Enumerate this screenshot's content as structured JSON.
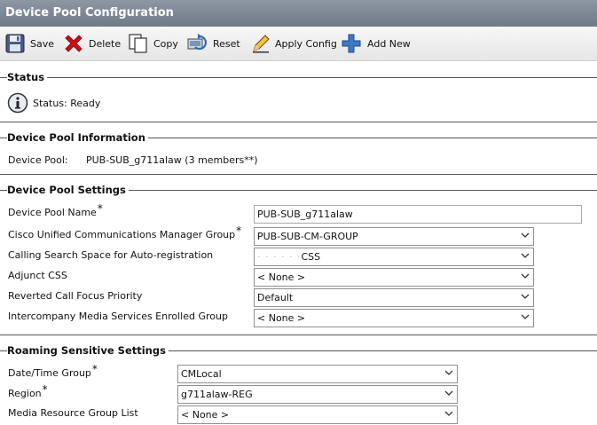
{
  "window": {
    "title": "Device Pool Configuration"
  },
  "toolbar": {
    "save_label": "Save",
    "delete_label": "Delete",
    "copy_label": "Copy",
    "reset_label": "Reset",
    "apply_label": "Apply Config",
    "add_label": "Add New"
  },
  "status": {
    "section_title": "Status",
    "text": "Status: Ready"
  },
  "info": {
    "section_title": "Device Pool Information",
    "label": "Device Pool:",
    "value": "PUB-SUB_g711alaw  (3 members**)"
  },
  "settings": {
    "section_title": "Device Pool Settings",
    "rows": [
      {
        "label": "Device Pool Name",
        "required": "*",
        "value": "PUB-SUB_g711alaw"
      },
      {
        "label": "Cisco Unified Communications Manager Group",
        "required": "*",
        "value": "PUB-SUB-CM-GROUP"
      },
      {
        "label": "Calling Search Space for Auto-registration",
        "required": "",
        "value_prefix": "· ·  ·  ·  · ·",
        "value": "CSS"
      },
      {
        "label": "Adjunct CSS",
        "required": "",
        "value": "< None >"
      },
      {
        "label": "Reverted Call Focus Priority",
        "required": "",
        "value": "Default"
      },
      {
        "label": "Intercompany Media Services Enrolled Group",
        "required": "",
        "value": "< None >"
      }
    ]
  },
  "roaming": {
    "section_title": "Roaming Sensitive Settings",
    "rows": [
      {
        "label": "Date/Time Group",
        "required": "*",
        "value": "CMLocal"
      },
      {
        "label": "Region",
        "required": "*",
        "value": "g711alaw-REG"
      },
      {
        "label": "Media Resource Group List",
        "required": "",
        "value": "< None >"
      }
    ]
  },
  "icons": {
    "save": "save-icon",
    "delete": "delete-icon",
    "copy": "copy-icon",
    "reset": "reset-icon",
    "apply": "apply-config-icon",
    "add": "add-icon",
    "info": "info-icon",
    "dropdown": "chevron-down-icon"
  },
  "colors": {
    "titlebar": "#7a8592",
    "delete_red": "#cc1111",
    "add_blue": "#3a78c9"
  }
}
